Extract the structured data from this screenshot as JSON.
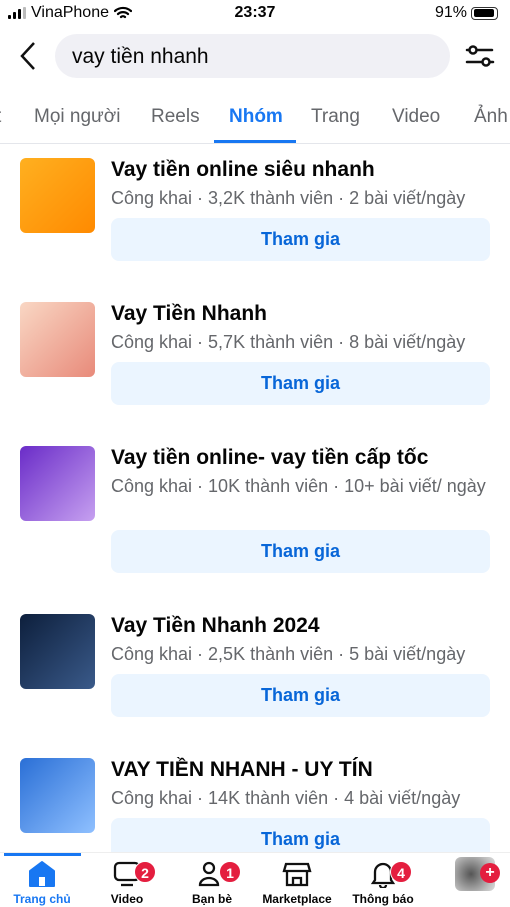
{
  "status": {
    "carrier": "VinaPhone",
    "time": "23:37",
    "battery": "91%",
    "battery_level": 0.91
  },
  "search": {
    "value": "vay tiền nhanh"
  },
  "tabs": [
    {
      "label": "t"
    },
    {
      "label": "Mọi người"
    },
    {
      "label": "Reels"
    },
    {
      "label": "Nhóm",
      "active": true
    },
    {
      "label": "Trang"
    },
    {
      "label": "Video"
    },
    {
      "label": "Ảnh"
    }
  ],
  "groups": [
    {
      "title": "Vay tiền online siêu nhanh",
      "meta": "Công khai · 3,2K thành viên · 2 bài viết/ngày",
      "join": "Tham gia",
      "colors": [
        "#ffb020",
        "#ff8a00"
      ]
    },
    {
      "title": "Vay Tiền Nhanh",
      "meta": "Công khai · 5,7K thành viên · 8 bài viết/ngày",
      "join": "Tham gia",
      "colors": [
        "#f9d7c4",
        "#e88a7a"
      ]
    },
    {
      "title": "Vay tiền online- vay tiền cấp tốc",
      "meta": "Công khai · 10K thành viên · 10+ bài viết/ ngày",
      "join": "Tham gia",
      "colors": [
        "#6a2cc8",
        "#c6a0f0"
      ]
    },
    {
      "title": "Vay Tiền Nhanh 2024",
      "meta": "Công khai · 2,5K thành viên · 5 bài viết/ngày",
      "join": "Tham gia",
      "colors": [
        "#0d1f3c",
        "#3a5a8a"
      ]
    },
    {
      "title": "VAY TIỀN NHANH - UY TÍN",
      "meta": "Công khai · 14K thành viên · 4 bài viết/ngày",
      "join": "Tham gia",
      "colors": [
        "#2a6fd6",
        "#8fc0ff"
      ]
    }
  ],
  "nav": [
    {
      "label": "Trang chủ",
      "icon": "home-icon",
      "active": true
    },
    {
      "label": "Video",
      "icon": "video-icon",
      "badge": "2"
    },
    {
      "label": "Bạn bè",
      "icon": "friends-icon",
      "badge": "1"
    },
    {
      "label": "Marketplace",
      "icon": "marketplace-icon"
    },
    {
      "label": "Thông báo",
      "icon": "bell-icon",
      "badge": "4"
    },
    {
      "label": "",
      "icon": "profile-avatar"
    }
  ],
  "accent": "#1877f2"
}
